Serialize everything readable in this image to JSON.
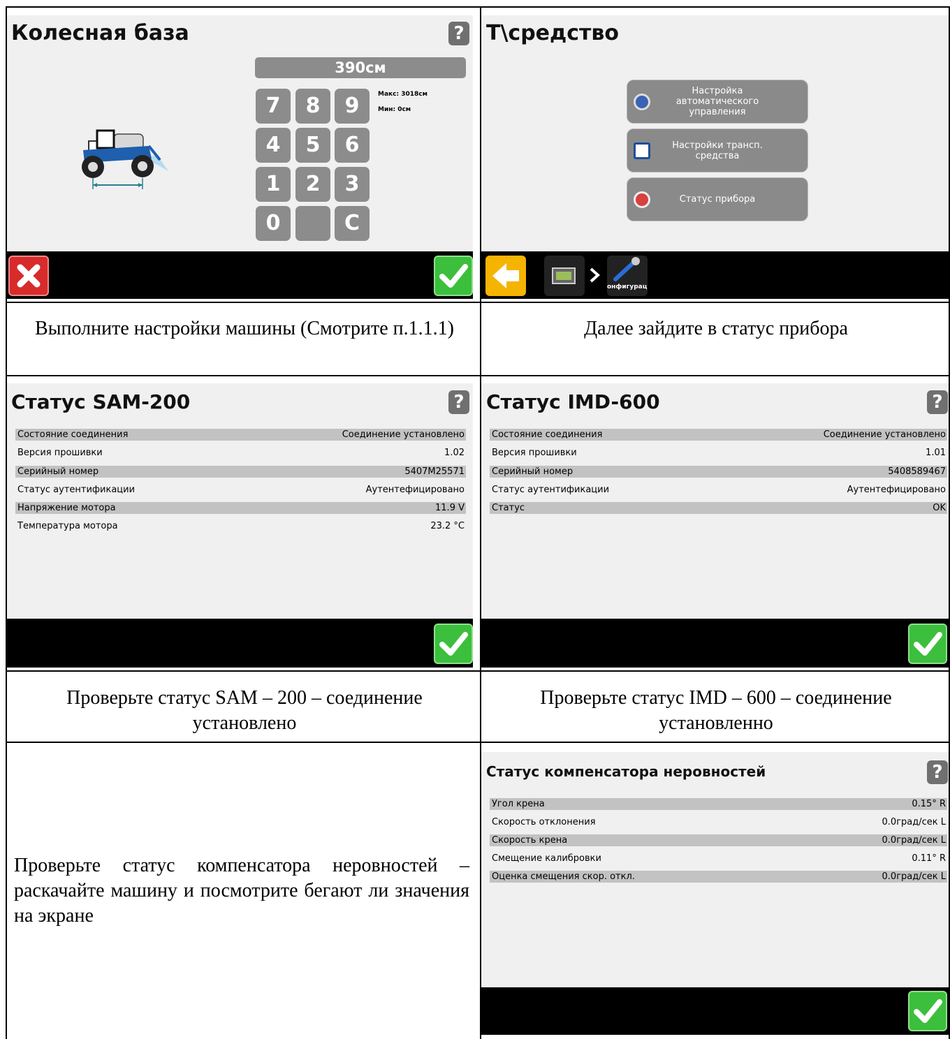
{
  "wheelbase": {
    "title": "Колесная база",
    "help": "?",
    "value": "390см",
    "max": "Макс: 3018см",
    "min": "Мин: 0см",
    "keys": [
      "7",
      "8",
      "9",
      "4",
      "5",
      "6",
      "1",
      "2",
      "3",
      "0",
      "",
      "C"
    ]
  },
  "vehicle_menu": {
    "title": "Т\\средство",
    "help": "?",
    "buttons": [
      {
        "label": "Настройка автоматического управления",
        "icon": "steering-wheel-icon"
      },
      {
        "label": "Настройки трансп. средства",
        "icon": "list-icon"
      },
      {
        "label": "Статус прибора",
        "icon": "gauge-icon"
      }
    ],
    "breadcrumb_label": "онфигурац"
  },
  "captions": {
    "c1": "Выполните настройки машины (Смотрите п.1.1.1)",
    "c2": "Далее зайдите в статус прибора",
    "c3": "Проверьте статус SAM – 200 – соединение установлено",
    "c4": "Проверьте статус IMD – 600 – соединение установленно",
    "c5": "Проверьте статус компенсатора неровностей – раскачайте машину и посмотрите бегают ли значения на экране"
  },
  "sam200": {
    "title": "Статус SAM-200",
    "help": "?",
    "rows": [
      {
        "k": "Состояние соединения",
        "v": "Соединение установлено"
      },
      {
        "k": "Версия прошивки",
        "v": "1.02"
      },
      {
        "k": "Серийный номер",
        "v": "5407M25571"
      },
      {
        "k": "Статус аутентификации",
        "v": "Аутентефицировано"
      },
      {
        "k": "Напряжение мотора",
        "v": "11.9 V"
      },
      {
        "k": "Температура мотора",
        "v": "23.2 °C"
      }
    ]
  },
  "imd600": {
    "title": "Статус IMD-600",
    "help": "?",
    "rows": [
      {
        "k": "Состояние соединения",
        "v": "Соединение установлено"
      },
      {
        "k": "Версия прошивки",
        "v": "1.01"
      },
      {
        "k": "Серийный номер",
        "v": "5408589467"
      },
      {
        "k": "Статус аутентификации",
        "v": "Аутентефицировано"
      },
      {
        "k": "Статус",
        "v": "OK"
      }
    ]
  },
  "compensator": {
    "title": "Статус компенсатора неровностей",
    "help": "?",
    "rows": [
      {
        "k": "Угол крена",
        "v": "0.15° R"
      },
      {
        "k": "Скорость отклонения",
        "v": "0.0град/сек L"
      },
      {
        "k": "Скорость крена",
        "v": "0.0град/сек L"
      },
      {
        "k": "Смещение калибровки",
        "v": "0.11° R"
      },
      {
        "k": "Оценка смещения скор. откл.",
        "v": "0.0град/сек L"
      }
    ]
  }
}
